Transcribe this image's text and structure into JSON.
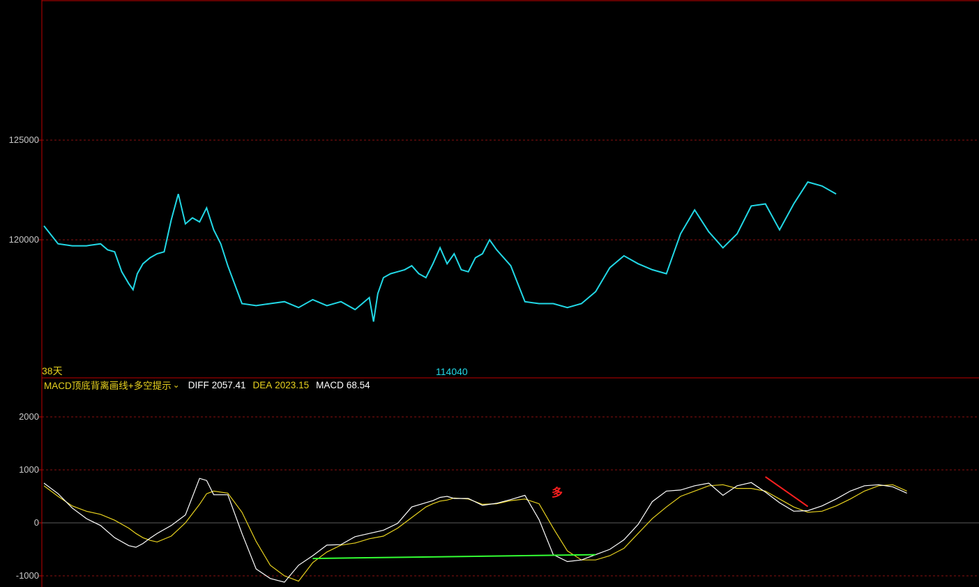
{
  "indicator": {
    "name": "MACD顶底背离画线+多空提示",
    "diff_label": "DIFF",
    "diff_value": "2057.41",
    "dea_label": "DEA",
    "dea_value": "2023.15",
    "macd_label": "MACD",
    "macd_value": "68.54"
  },
  "annotations": {
    "days": "38天",
    "low_price": "114040",
    "signal": "多"
  },
  "colors": {
    "background": "#000000",
    "frame": "#c00000",
    "grid": "#8a1010",
    "up": "#ff3b3b",
    "down": "#22d8e6",
    "diff_line": "#ffffff",
    "dea_line": "#e8d21f",
    "bull_fill": "#8b0000",
    "bear_fill": "#1f6b10",
    "bottom_div_line": "#33ff33",
    "top_div_line": "#ff2020",
    "axis_text": "#c8c8c8"
  },
  "chart_data": [
    {
      "type": "line",
      "panel": "price",
      "y_ticks": [
        120000,
        125000
      ],
      "y_tick_labels": [
        "120000",
        "125000"
      ],
      "grid": true,
      "x": [
        0,
        10,
        20,
        30,
        40,
        45,
        50,
        55,
        60,
        63,
        66,
        70,
        75,
        80,
        85,
        90,
        95,
        100,
        105,
        110,
        115,
        120,
        125,
        130,
        140,
        150,
        160,
        170,
        180,
        190,
        200,
        210,
        220,
        225,
        230,
        233,
        236,
        240,
        245,
        250,
        255,
        260,
        265,
        270,
        275,
        280,
        285,
        290,
        295,
        300,
        305,
        310,
        315,
        320,
        330,
        340,
        350,
        360,
        370,
        380,
        390,
        400,
        410,
        420,
        430,
        440,
        450,
        460,
        470,
        480,
        490,
        500,
        510,
        520,
        530,
        540,
        550,
        560,
        570,
        580,
        590,
        600,
        610,
        620,
        630,
        640,
        650,
        660
      ],
      "series": [
        {
          "values": [
            120700,
            119800,
            119700,
            119700,
            119800,
            119500,
            119400,
            118400,
            117800,
            117500,
            118300,
            118800,
            119100,
            119300,
            119400,
            121000,
            122300,
            120800,
            121100,
            120900,
            121600,
            120500,
            119800,
            118700,
            116800,
            116700,
            116800,
            116900,
            116600,
            117000,
            116700,
            116900,
            116500,
            116800,
            117100,
            115900,
            117300,
            118100,
            118300,
            118400,
            118500,
            118700,
            118300,
            118100,
            118800,
            119600,
            118800,
            119300,
            118500,
            118400,
            119100,
            119300,
            120000,
            119500,
            118700,
            116900,
            116800,
            116800,
            116600,
            116800,
            117400,
            118600,
            119200,
            118800,
            118500,
            118300,
            120300,
            121500,
            120400,
            119600,
            120300,
            121700,
            121800,
            120500,
            121800,
            122900,
            122700,
            122300
          ]
        }
      ]
    },
    {
      "type": "line",
      "panel": "macd",
      "y_ticks": [
        -1000,
        0,
        1000,
        2000
      ],
      "y_tick_labels": [
        "-1000",
        "0",
        "1000",
        "2000"
      ],
      "grid": true,
      "x": [
        0,
        10,
        20,
        30,
        40,
        50,
        60,
        65,
        70,
        75,
        80,
        90,
        100,
        110,
        115,
        120,
        130,
        140,
        150,
        160,
        170,
        180,
        190,
        200,
        210,
        220,
        230,
        240,
        250,
        260,
        270,
        275,
        280,
        285,
        290,
        300,
        310,
        320,
        330,
        340,
        350,
        360,
        370,
        380,
        390,
        400,
        410,
        420,
        430,
        440,
        450,
        460,
        470,
        480,
        490,
        500,
        510,
        520,
        530,
        540,
        550,
        560,
        570,
        580,
        590,
        600,
        610,
        620,
        630,
        640,
        650,
        660
      ],
      "series": [
        {
          "name": "DIFF",
          "values": [
            750,
            550,
            280,
            80,
            -50,
            -280,
            -430,
            -460,
            -390,
            -290,
            -200,
            -50,
            150,
            840,
            800,
            530,
            530,
            -200,
            -870,
            -1050,
            -1120,
            -800,
            -620,
            -420,
            -410,
            -260,
            -200,
            -140,
            -10,
            300,
            380,
            420,
            480,
            500,
            460,
            460,
            330,
            370,
            440,
            520,
            60,
            -600,
            -730,
            -700,
            -600,
            -500,
            -320,
            -30,
            400,
            600,
            620,
            700,
            750,
            520,
            700,
            760,
            580,
            380,
            220,
            230,
            320,
            450,
            600,
            700,
            720,
            680,
            560
          ]
        },
        {
          "name": "DEA",
          "values": [
            700,
            500,
            320,
            220,
            160,
            50,
            -100,
            -200,
            -280,
            -330,
            -360,
            -250,
            0,
            350,
            550,
            600,
            560,
            200,
            -350,
            -800,
            -1000,
            -1100,
            -750,
            -550,
            -420,
            -380,
            -300,
            -250,
            -100,
            100,
            300,
            360,
            410,
            430,
            470,
            450,
            350,
            360,
            420,
            450,
            360,
            -100,
            -530,
            -700,
            -700,
            -620,
            -480,
            -200,
            80,
            300,
            500,
            600,
            700,
            720,
            650,
            650,
            600,
            450,
            300,
            200,
            220,
            320,
            450,
            600,
            700,
            720,
            600
          ]
        }
      ]
    }
  ]
}
